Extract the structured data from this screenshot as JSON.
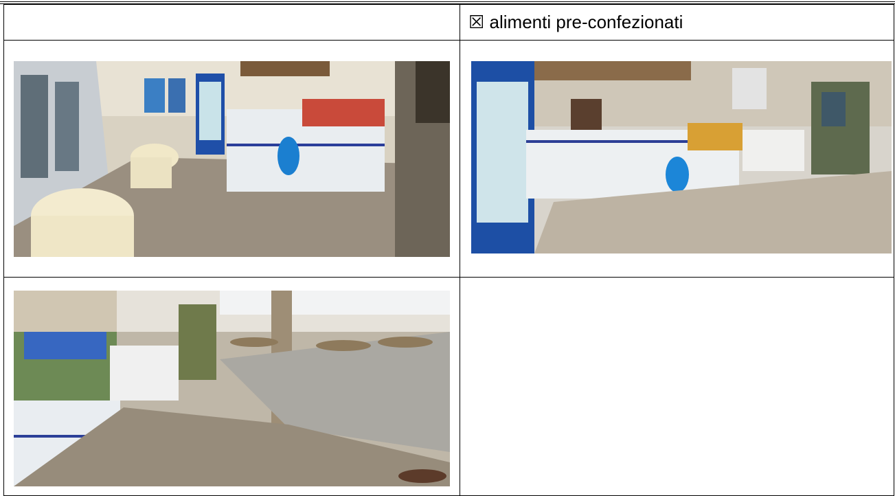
{
  "header_cell": {
    "checkbox_symbol": "☒",
    "label": "alimenti pre-confezionati"
  },
  "photos": [
    {
      "icon": "bar-interior-photo"
    },
    {
      "icon": "bar-counter-photo"
    },
    {
      "icon": "terrace-seating-photo"
    }
  ]
}
